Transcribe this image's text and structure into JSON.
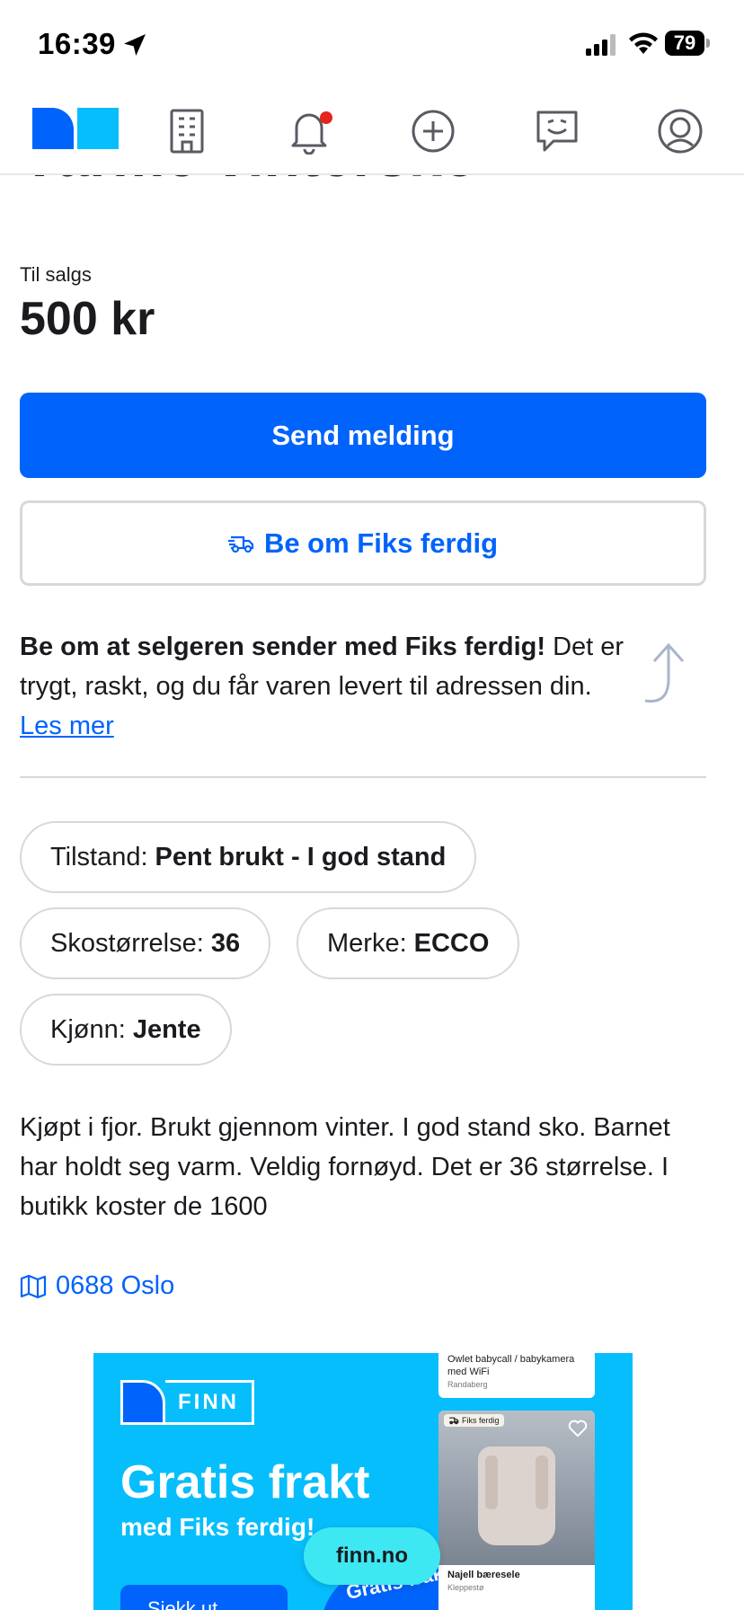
{
  "status_bar": {
    "time": "16:39",
    "battery": "79"
  },
  "nav": {
    "items": [
      "finn-logo",
      "building-icon",
      "bell-icon",
      "plus-circle-icon",
      "chat-icon",
      "profile-icon"
    ],
    "has_notification": true,
    "brand_colors": {
      "primary": "#0063fb",
      "secondary": "#06befb"
    }
  },
  "listing": {
    "title": "Varme vintersko",
    "price_label": "Til salgs",
    "price": "500 kr",
    "send_message_label": "Send melding",
    "fiks_ferdig_label": "Be om Fiks ferdig",
    "info_bold": "Be om at selgeren sender med Fiks ferdig!",
    "info_rest": " Det er trygt, raskt, og du får varen levert til adressen din. ",
    "info_link": "Les mer",
    "attributes": [
      {
        "label": "Tilstand:",
        "value": "Pent brukt - I god stand"
      },
      {
        "label": "Skostørrelse:",
        "value": "36"
      },
      {
        "label": "Merke:",
        "value": "ECCO"
      },
      {
        "label": "Kjønn:",
        "value": "Jente"
      }
    ],
    "description": "Kjøpt i fjor. Brukt gjennom vinter. I god stand sko. Barnet har holdt seg varm. Veldig fornøyd. Det er 36 størrelse. I butikk koster de 1600",
    "location": "0688 Oslo"
  },
  "ad": {
    "logo_text": "FINN",
    "title": "Gratis frakt",
    "subtitle": "med Fiks ferdig!",
    "cta": "Sjekk ut",
    "badge": "Gratis frakt",
    "card1_title": "Owlet babycall / babykamera med WiFi",
    "card1_location": "Randaberg",
    "card2_tag": "Fiks ferdig",
    "card2_title": "Najell bæresele",
    "card2_location": "Kleppestø"
  },
  "floating_pill": "finn.no"
}
